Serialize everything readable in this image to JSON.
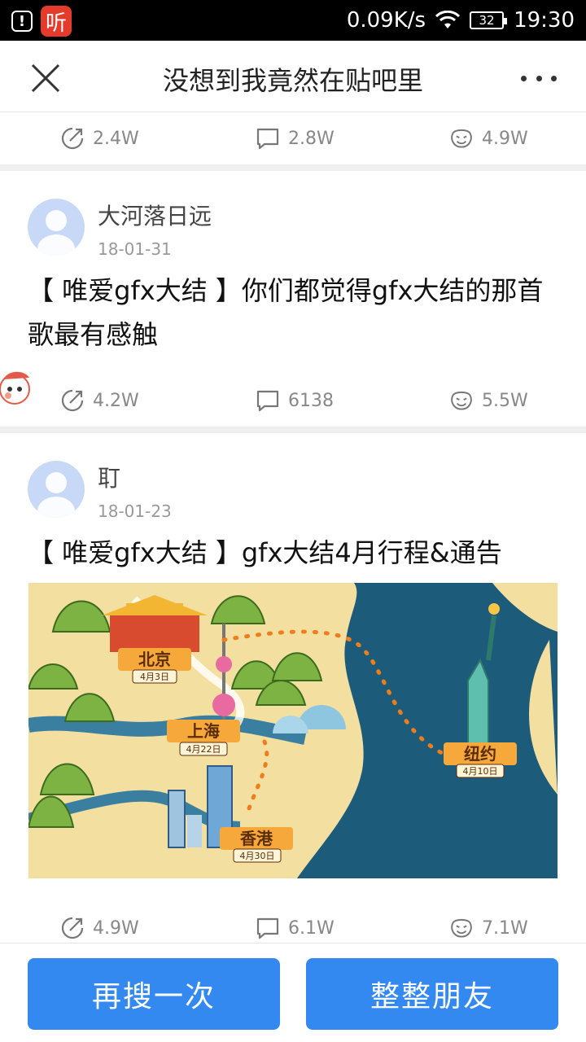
{
  "status_bar": {
    "alert": "!",
    "app_badge": "听",
    "speed": "0.09K/s",
    "battery": "32",
    "time": "19:30"
  },
  "nav": {
    "title": "没想到我竟然在贴吧里"
  },
  "partial_post": {
    "shares": "2.4W",
    "comments": "2.8W",
    "likes": "4.9W"
  },
  "posts": [
    {
      "username": "大河落日远",
      "date": "18-01-31",
      "title": "【 唯爱gfx大结 】你们都觉得gfx大结的那首歌最有感触",
      "shares": "4.2W",
      "comments": "6138",
      "likes": "5.5W"
    },
    {
      "username": "耵",
      "date": "18-01-23",
      "title": "【 唯爱gfx大结 】gfx大结4月行程&通告",
      "shares": "4.9W",
      "comments": "6.1W",
      "likes": "7.1W",
      "map": {
        "beijing": "北京",
        "beijing_date": "4月3日",
        "shanghai": "上海",
        "shanghai_date": "4月22日",
        "hongkong": "香港",
        "hongkong_date": "4月30日",
        "newyork": "纽约",
        "newyork_date": "4月10日"
      }
    }
  ],
  "buttons": {
    "search_again": "再搜一次",
    "prank_friend": "整整朋友"
  },
  "colors": {
    "accent": "#3389f0",
    "alert_red": "#e53b2c"
  }
}
